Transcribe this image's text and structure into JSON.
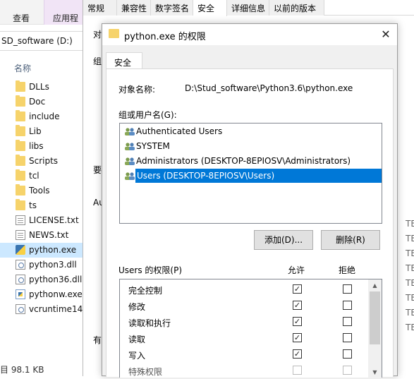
{
  "explorer": {
    "ribbon_tabs": [
      "查看",
      "应用程"
    ],
    "address": "SD_software (D:)",
    "column_header": "名称",
    "files": [
      {
        "name": "DLLs",
        "icon": "folder-icon"
      },
      {
        "name": "Doc",
        "icon": "folder-icon"
      },
      {
        "name": "include",
        "icon": "folder-icon"
      },
      {
        "name": "Lib",
        "icon": "folder-icon"
      },
      {
        "name": "libs",
        "icon": "folder-icon"
      },
      {
        "name": "Scripts",
        "icon": "folder-icon"
      },
      {
        "name": "tcl",
        "icon": "folder-icon"
      },
      {
        "name": "Tools",
        "icon": "folder-icon"
      },
      {
        "name": "ts",
        "icon": "folder-icon"
      },
      {
        "name": "LICENSE.txt",
        "icon": "text-file-icon"
      },
      {
        "name": "NEWS.txt",
        "icon": "text-file-icon"
      },
      {
        "name": "python.exe",
        "icon": "python-exe-icon",
        "selected": true
      },
      {
        "name": "python3.dll",
        "icon": "dll-file-icon"
      },
      {
        "name": "python36.dll",
        "icon": "dll-file-icon"
      },
      {
        "name": "pythonw.exe",
        "icon": "pythonw-exe-icon"
      },
      {
        "name": "vcruntime14",
        "icon": "dll-file-icon"
      }
    ],
    "status_size": "目 98.1 KB",
    "right_edge": [
      "TB",
      "TB",
      "TB",
      "TB",
      "TB",
      "TB",
      "TB",
      "TB"
    ]
  },
  "properties_dialog": {
    "tabs": [
      "常规",
      "兼容性",
      "数字签名",
      "安全",
      "详细信息",
      "以前的版本"
    ],
    "active_tab": "安全",
    "fragments": [
      "对",
      "组",
      "要",
      "Au",
      "有"
    ]
  },
  "permission_dialog": {
    "title": "python.exe 的权限",
    "close_glyph": "✕",
    "tab_label": "安全",
    "object_name_label": "对象名称:",
    "object_name_value": "D:\\Stud_software\\Python3.6\\python.exe",
    "users_group_label": "组或用户名(G):",
    "users": [
      {
        "name": "Authenticated Users",
        "icon": "user-group-icon",
        "selected": false
      },
      {
        "name": "SYSTEM",
        "icon": "user-group-icon",
        "selected": false
      },
      {
        "name": "Administrators (DESKTOP-8EPIOSV\\Administrators)",
        "icon": "user-group-icon",
        "selected": false
      },
      {
        "name": "Users (DESKTOP-8EPIOSV\\Users)",
        "icon": "user-group-icon",
        "selected": true
      }
    ],
    "add_button": "添加(D)...",
    "remove_button": "删除(R)",
    "permissions_label": "Users 的权限(P)",
    "allow_header": "允许",
    "deny_header": "拒绝",
    "permissions": [
      {
        "name": "完全控制",
        "allow": true,
        "deny": false
      },
      {
        "name": "修改",
        "allow": true,
        "deny": false
      },
      {
        "name": "读取和执行",
        "allow": true,
        "deny": false
      },
      {
        "name": "读取",
        "allow": true,
        "deny": false
      },
      {
        "name": "写入",
        "allow": true,
        "deny": false
      },
      {
        "name": "特殊权限",
        "allow": false,
        "deny": false
      }
    ],
    "check_glyph": "✓"
  },
  "colors": {
    "selection": "#0078d7",
    "folder": "#f6d36b",
    "explorer_selection": "#cce8ff"
  }
}
